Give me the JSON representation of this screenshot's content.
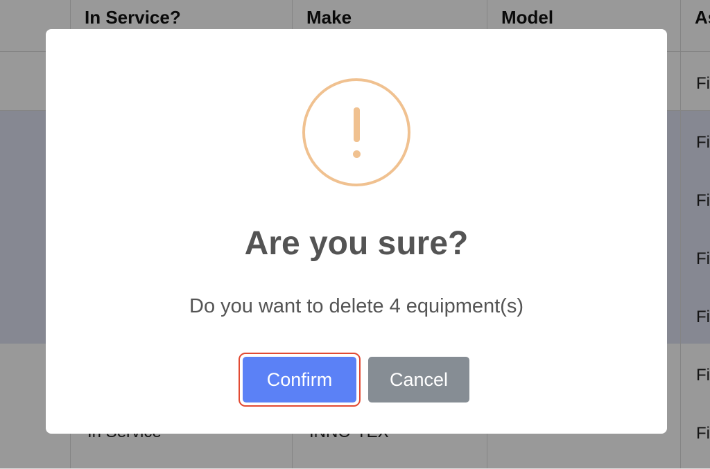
{
  "table": {
    "columns": [
      "",
      "In Service?",
      "Make",
      "Model",
      "As"
    ],
    "rows": [
      {
        "in_service": "",
        "make": "",
        "model": "",
        "asset": "Fi",
        "selected": false
      },
      {
        "in_service": "",
        "make": "",
        "model": "",
        "asset": "Fi",
        "selected": true
      },
      {
        "in_service": "",
        "make": "",
        "model": "",
        "asset": "Fi",
        "selected": true
      },
      {
        "in_service": "",
        "make": "",
        "model": "",
        "asset": "Fi",
        "selected": true
      },
      {
        "in_service": "",
        "make": "",
        "model": "",
        "asset": "Fi",
        "selected": true
      },
      {
        "in_service": "",
        "make": "",
        "model": "",
        "asset": "Fi",
        "selected": false
      },
      {
        "in_service": "In Service",
        "make": "INNO-TEX",
        "model": "",
        "asset": "Fi",
        "selected": false
      }
    ]
  },
  "dialog": {
    "icon": "warning-icon",
    "title": "Are you sure?",
    "message": "Do you want to delete 4 equipment(s)",
    "confirm_label": "Confirm",
    "cancel_label": "Cancel"
  },
  "colors": {
    "confirm": "#5b81f6",
    "cancel": "#868d94",
    "warning": "#f0c190",
    "focus_ring": "#e24a33",
    "selected_row": "#dfe3f3"
  }
}
